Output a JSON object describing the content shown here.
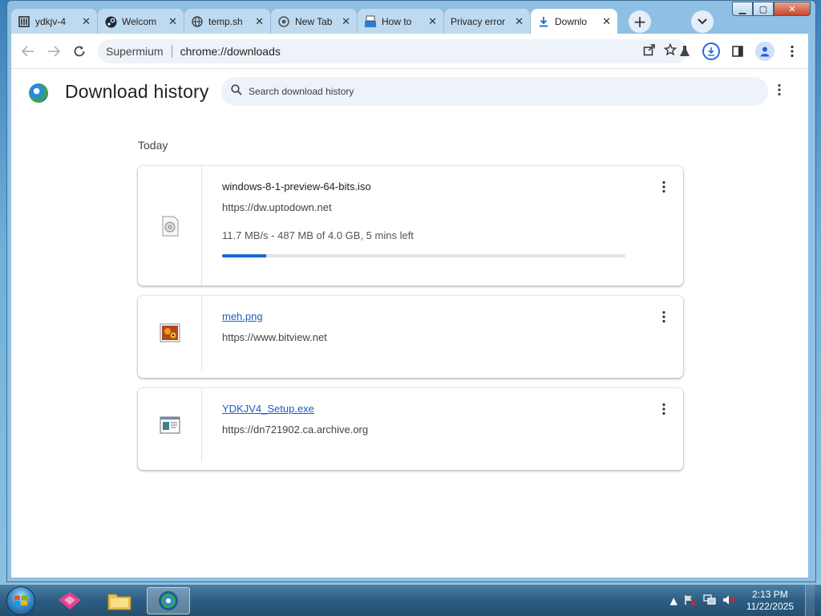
{
  "window": {
    "controls": {
      "minimize": "▁",
      "maximize": "▢",
      "close": "✕"
    }
  },
  "tabs": [
    {
      "label": "ydkjv-4",
      "icon": "archive-icon",
      "active": false
    },
    {
      "label": "Welcom",
      "icon": "steam-icon",
      "active": false
    },
    {
      "label": "temp.sh",
      "icon": "globe-icon",
      "active": false
    },
    {
      "label": "New Tab",
      "icon": "chrome-icon",
      "active": false
    },
    {
      "label": "How to",
      "icon": "bitview-icon",
      "active": false
    },
    {
      "label": "Privacy error",
      "icon": "",
      "active": false
    },
    {
      "label": "Downlo",
      "icon": "download-icon",
      "active": true
    }
  ],
  "toolbar": {
    "brand": "Supermium",
    "url": "chrome://downloads"
  },
  "page": {
    "title": "Download history",
    "search_placeholder": "Search download history",
    "section_date": "Today"
  },
  "downloads": [
    {
      "filename": "windows-8-1-preview-64-bits.iso",
      "source": "https://dw.uptodown.net",
      "status": "11.7 MB/s - 487 MB of 4.0 GB, 5 mins left",
      "progress_percent": 11,
      "link": false,
      "icon": "disc-file-icon"
    },
    {
      "filename": "meh.png",
      "source": "https://www.bitview.net",
      "status": "",
      "link": true,
      "icon": "image-file-icon"
    },
    {
      "filename": "YDKJV4_Setup.exe",
      "source": "https://dn721902.ca.archive.org",
      "status": "",
      "link": true,
      "icon": "exe-file-icon"
    }
  ],
  "taskbar": {
    "time": "2:13 PM",
    "date": "11/22/2025"
  },
  "colors": {
    "accent": "#1a67d2",
    "link": "#1a5fc8"
  }
}
